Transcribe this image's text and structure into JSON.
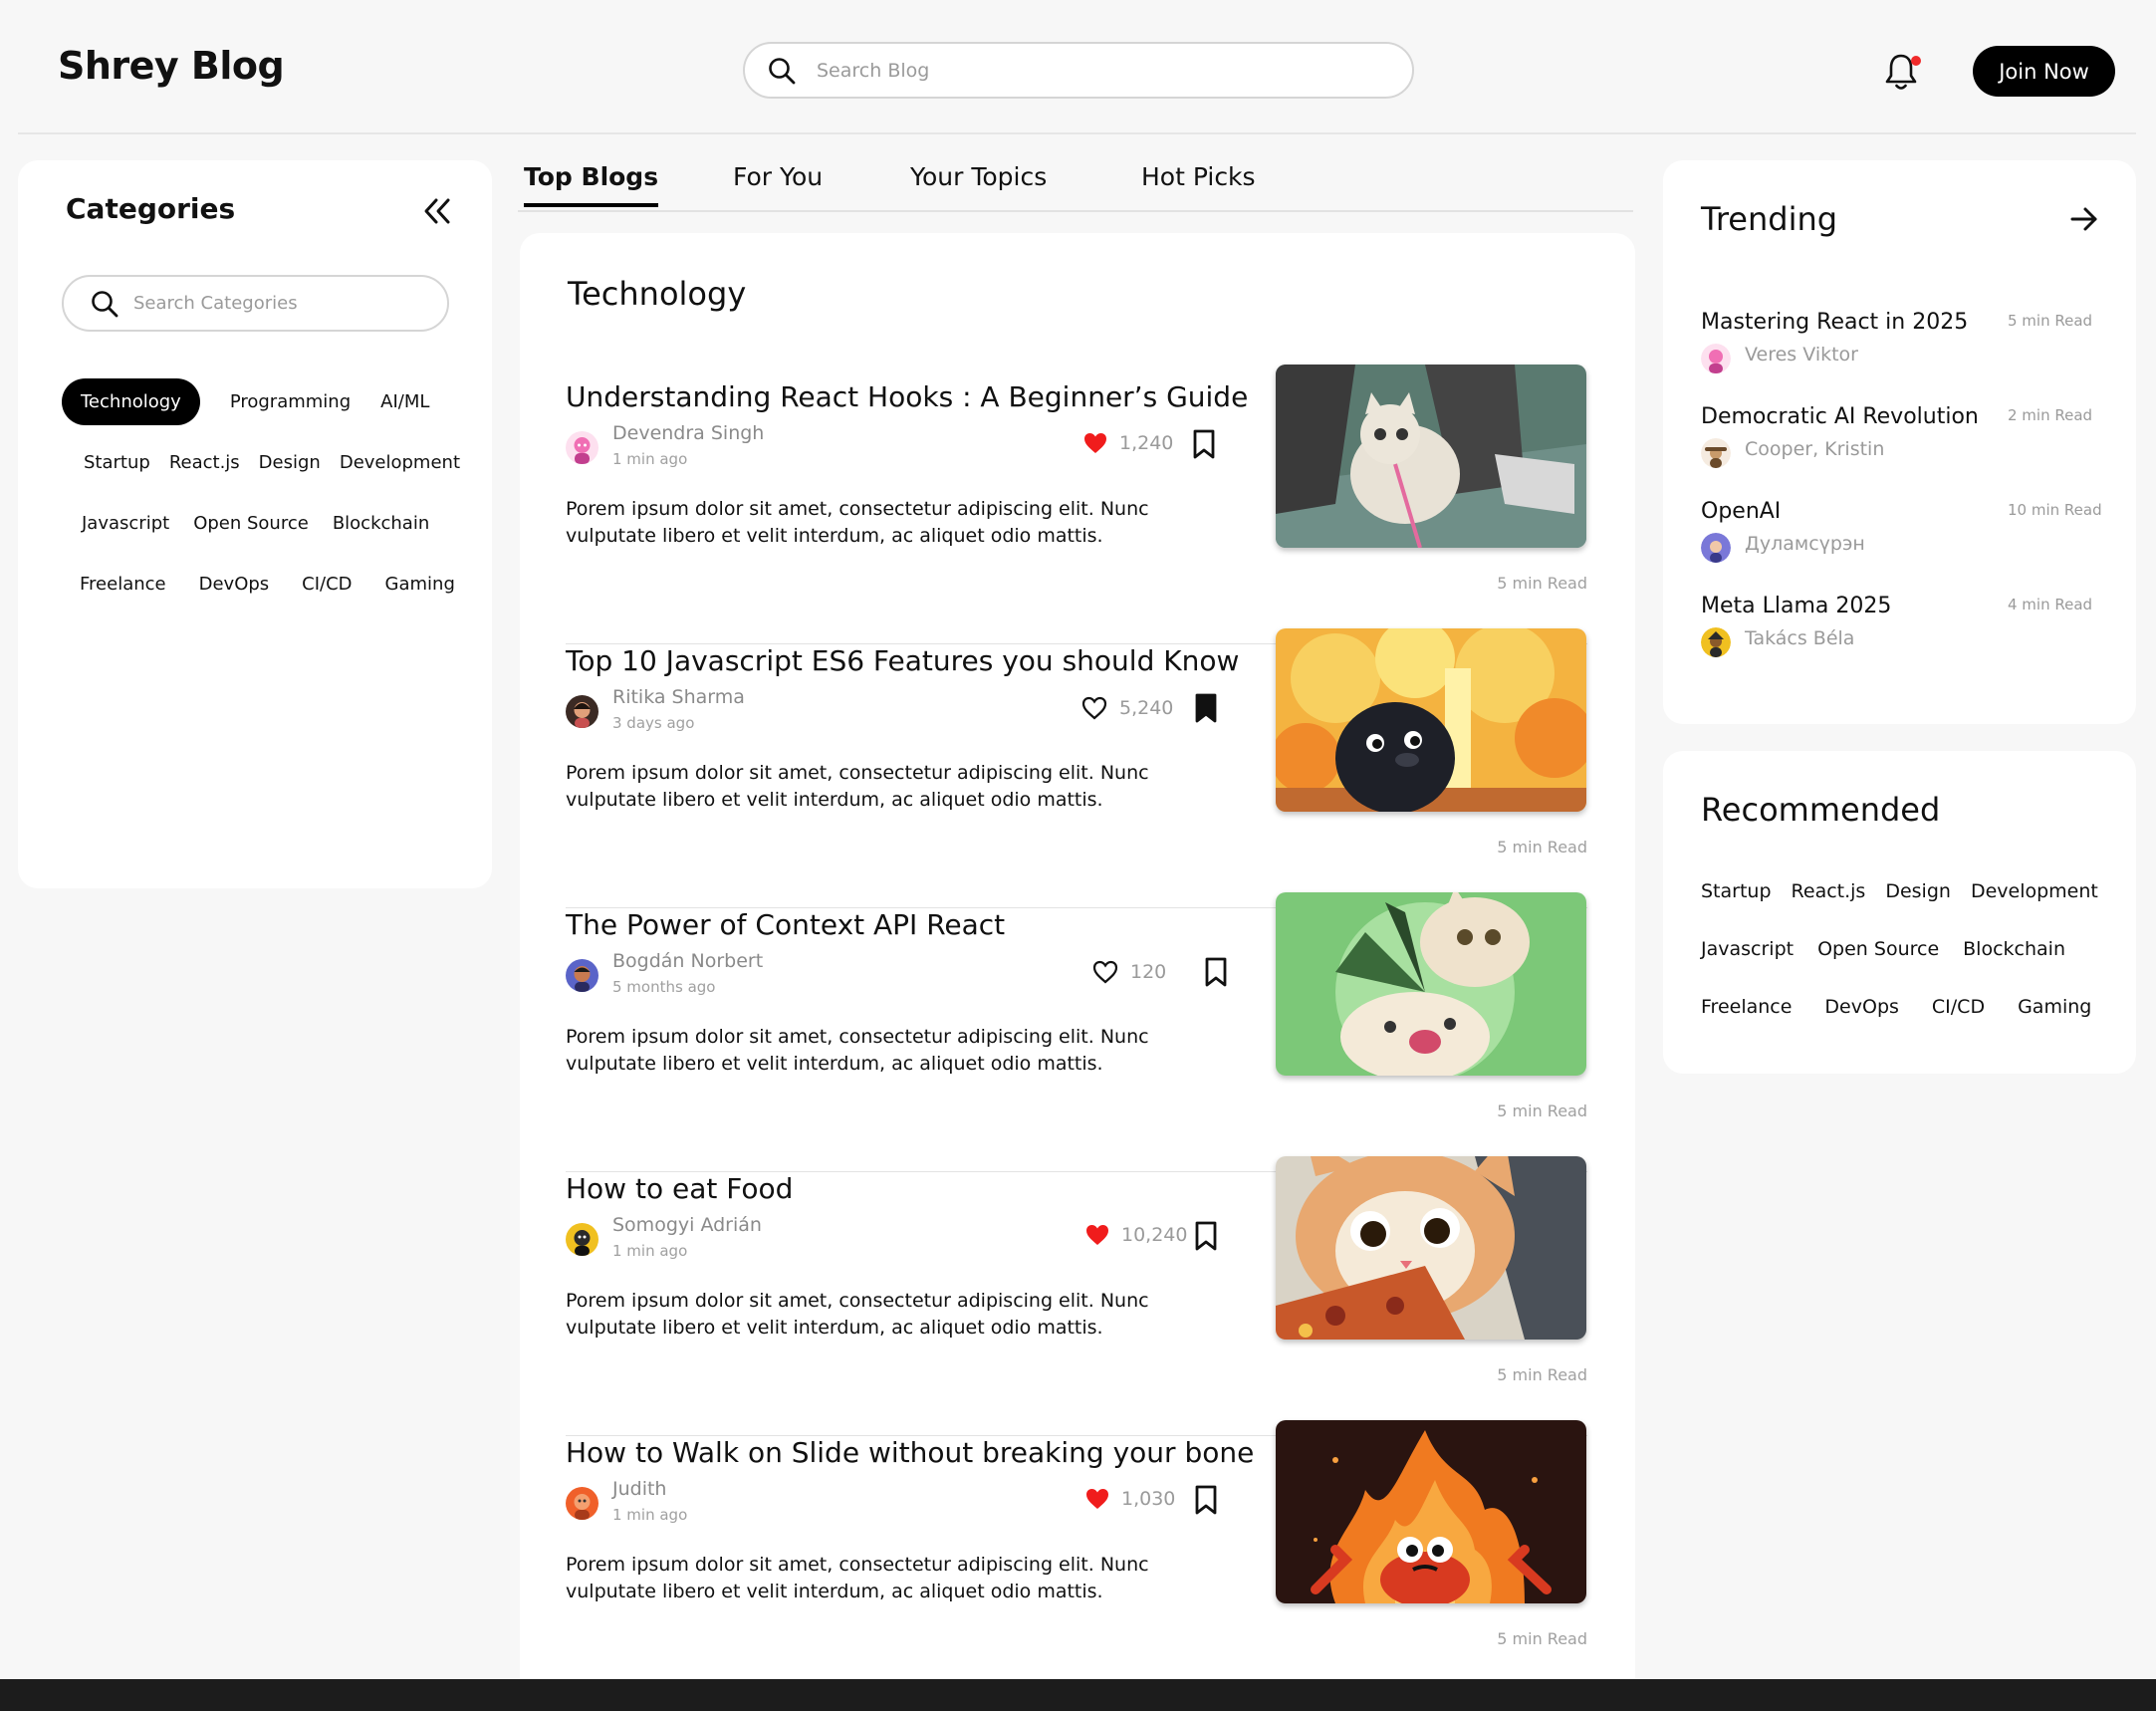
{
  "header": {
    "brand": "Shrey Blog",
    "search_placeholder": "Search Blog",
    "join_label": "Join Now"
  },
  "categories": {
    "title": "Categories",
    "search_placeholder": "Search Categories",
    "rows": [
      [
        "Technology",
        "Programming",
        "AI/ML"
      ],
      [
        "Startup",
        "React.js",
        "Design",
        "Development"
      ],
      [
        "Javascript",
        "Open Source",
        "Blockchain"
      ],
      [
        "Freelance",
        "DevOps",
        "CI/CD",
        "Gaming"
      ]
    ],
    "active": "Technology"
  },
  "tabs": [
    "Top Blogs",
    "For You",
    "Your Topics",
    "Hot Picks"
  ],
  "active_tab": "Top Blogs",
  "feed": {
    "title": "Technology",
    "posts": [
      {
        "title": "Understanding React Hooks : A Beginner’s Guide",
        "author": "Devendra Singh",
        "time": "1 min ago",
        "likes": "1,240",
        "liked": true,
        "bookmarked": false,
        "excerpt": "Porem ipsum dolor sit amet, consectetur adipiscing elit. Nunc vulputate libero et velit interdum, ac aliquet odio mattis.",
        "read": "5 min Read",
        "avatar_color": "#f06fb4",
        "image": "cat-on-street"
      },
      {
        "title": "Top 10 Javascript ES6 Features you should Know",
        "author": "Ritika Sharma",
        "time": "3 days ago",
        "likes": "5,240",
        "liked": false,
        "bookmarked": true,
        "excerpt": "Porem ipsum dolor sit amet, consectetur adipiscing elit. Nunc vulputate libero et velit interdum, ac aliquet odio mattis.",
        "read": "5 min Read",
        "avatar_color": "#3b2a24",
        "image": "explosion-bird"
      },
      {
        "title": "The Power of Context API React",
        "author": "Bogdán Norbert",
        "time": "5 months ago",
        "likes": "120",
        "liked": false,
        "bookmarked": false,
        "excerpt": "Porem ipsum dolor sit amet, consectetur adipiscing elit. Nunc vulputate libero et velit interdum, ac aliquet odio mattis.",
        "read": "5 min Read",
        "avatar_color": "#5a64c8",
        "image": "cats-fighting"
      },
      {
        "title": "How to eat Food",
        "author": "Somogyi Adrián",
        "time": "1 min ago",
        "likes": "10,240",
        "liked": true,
        "bookmarked": false,
        "excerpt": "Porem ipsum dolor sit amet, consectetur adipiscing elit. Nunc vulputate libero et velit interdum, ac aliquet odio mattis.",
        "read": "5 min Read",
        "avatar_color": "#f0c020",
        "image": "cat-eating-pizza"
      },
      {
        "title": "How to Walk on Slide without breaking your bone",
        "author": "Judith",
        "time": "1 min ago",
        "likes": "1,030",
        "liked": true,
        "bookmarked": false,
        "excerpt": "Porem ipsum dolor sit amet, consectetur adipiscing elit. Nunc vulputate libero et velit interdum, ac aliquet odio mattis.",
        "read": "5 min Read",
        "avatar_color": "#f0602a",
        "image": "fire-monster"
      }
    ]
  },
  "trending": {
    "title": "Trending",
    "items": [
      {
        "title": "Mastering React in 2025",
        "author": "Veres Viktor",
        "read": "5 min Read",
        "avatar_color": "#f06fb4"
      },
      {
        "title": "Democratic AI Revolution",
        "author": "Cooper, Kristin",
        "read": "2 min Read",
        "avatar_color": "#c89a6a"
      },
      {
        "title": "OpenAI",
        "author": "Дуламсүрэн",
        "read": "10 min Read",
        "avatar_color": "#7a78d8"
      },
      {
        "title": "Meta Llama 2025",
        "author": "Takács Béla",
        "read": "4 min Read",
        "avatar_color": "#f0c020"
      }
    ]
  },
  "recommended": {
    "title": "Recommended",
    "rows": [
      [
        "Startup",
        "React.js",
        "Design",
        "Development"
      ],
      [
        "Javascript",
        "Open Source",
        "Blockchain"
      ],
      [
        "Freelance",
        "DevOps",
        "CI/CD",
        "Gaming"
      ]
    ]
  },
  "colors": {
    "accent": "#000000",
    "like_red": "#f01c1c",
    "notification_dot": "#f02a2a",
    "page_bg": "#f7f7f7"
  }
}
